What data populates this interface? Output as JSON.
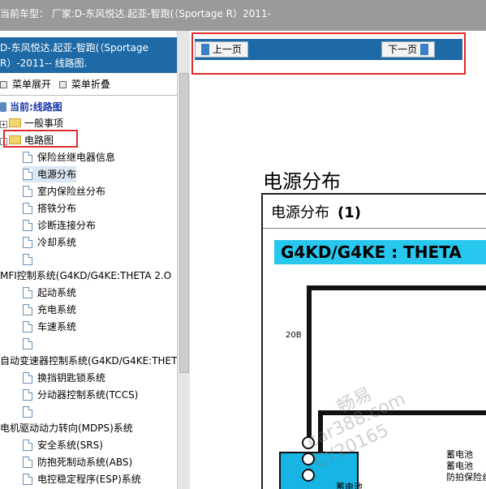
{
  "header": {
    "vehicle_text": "当前车型：  厂家:D-东风悦达.起亚-智跑(（Sportage R）2011-"
  },
  "left_panel": {
    "title_line1": "D-东风悦达.起亚-智跑(（Sportage",
    "title_line2": "R）-2011-- 线路图.",
    "expand_label": "菜单展开",
    "collapse_label": "菜单折叠",
    "current_label": "当前:线路图",
    "tree": {
      "general": "一般事项",
      "circuit": "电路图",
      "items_group1": [
        "保险丝继电器信息",
        "电源分布",
        "室内保险丝分布",
        "搭铁分布",
        "诊断连接分布",
        "冷却系统",
        ""
      ],
      "mfi": "MFI控制系统(G4KD/G4KE:THETA 2.O",
      "items_group2": [
        "起动系统",
        "充电系统",
        "车速系统",
        ""
      ],
      "at": "自动变速器控制系统(G4KD/G4KE:THET",
      "items_group3": [
        "换挡钥匙锁系统",
        "分动器控制系统(TCCS)",
        ""
      ],
      "mdps": "电机驱动动力转向(MDPS)系统",
      "items_group4": [
        "安全系统(SRS)",
        "防抱死制动系统(ABS)",
        "电控稳定程序(ESP)系统"
      ]
    }
  },
  "right_panel": {
    "prev_label": "上一页",
    "next_label": "下一页",
    "doc_title": "电源分布",
    "figure_title": "电源分布",
    "figure_number": "(1)",
    "engine_label": "G4KD/G4KE : THETA",
    "wire_label": "20B",
    "battery_label_1": "蓄电池",
    "battery_label_2": "蓄电池",
    "battery_label_3": "防拍保险丝盒",
    "battery_label_4": "蓄电池"
  },
  "watermark": {
    "line1": "畅易",
    "line2": "car388.com",
    "line3": "CY20165"
  },
  "colors": {
    "header_gray": "#9a9a9a",
    "panel_blue": "#1e6aa6",
    "highlight_red": "#e12b2b",
    "engine_cyan": "#28c7ee"
  }
}
